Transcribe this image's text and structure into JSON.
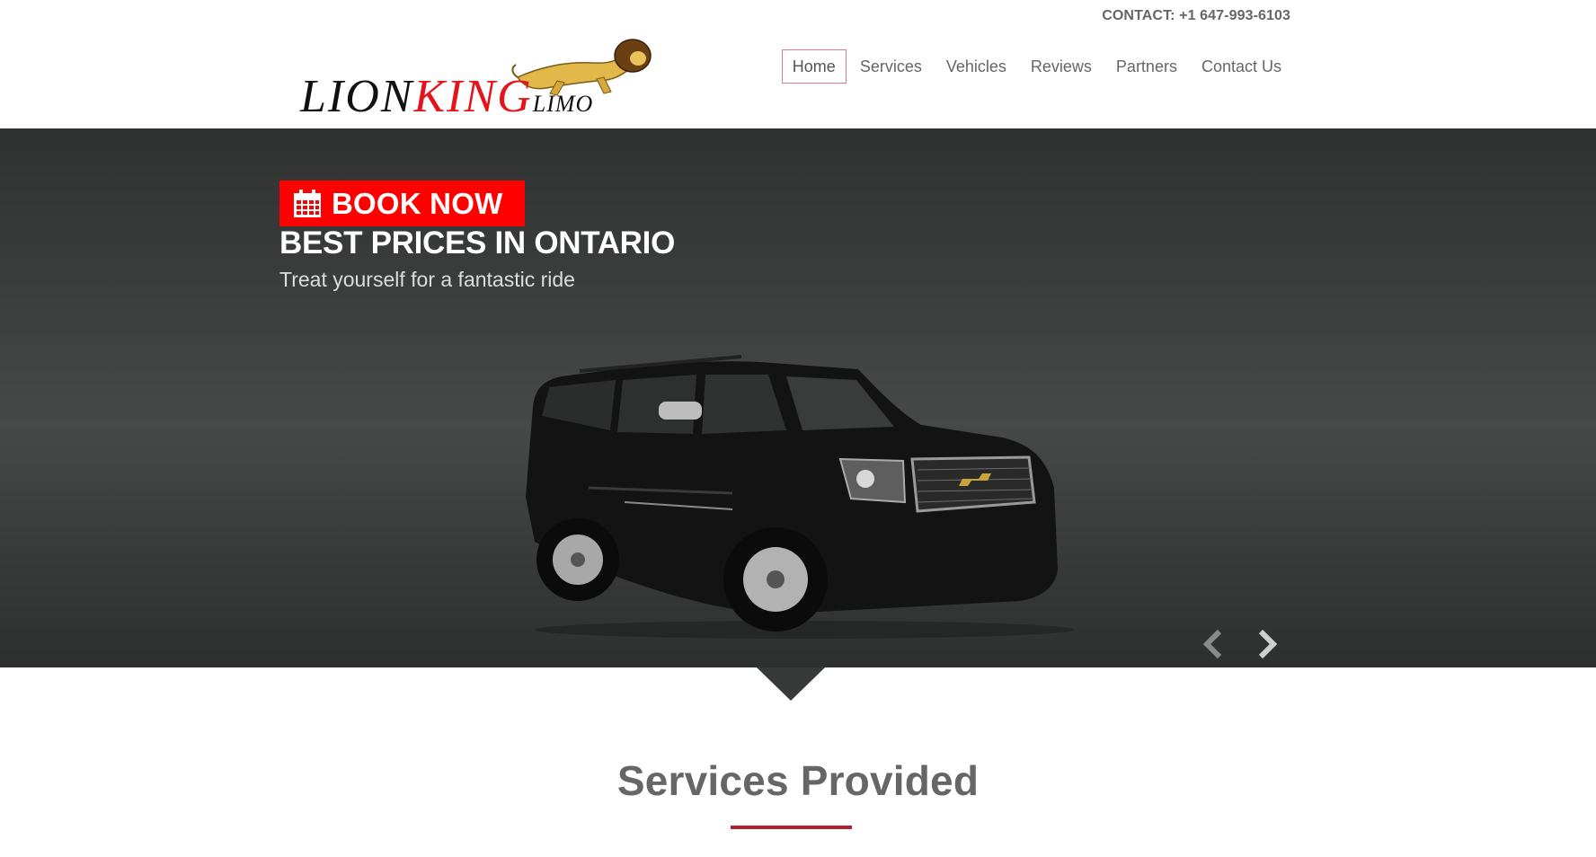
{
  "header": {
    "contact": "CONTACT: +1 647-993-6103",
    "logo": {
      "word1": "LION",
      "word2": "KING",
      "word3": "LIMO"
    },
    "nav": [
      {
        "label": "Home",
        "active": true
      },
      {
        "label": "Services",
        "active": false
      },
      {
        "label": "Vehicles",
        "active": false
      },
      {
        "label": "Reviews",
        "active": false
      },
      {
        "label": "Partners",
        "active": false
      },
      {
        "label": "Contact Us",
        "active": false
      }
    ]
  },
  "hero": {
    "book_now": "BOOK NOW",
    "title": "BEST PRICES IN ONTARIO",
    "subtitle": "Treat yourself for a fantastic ride",
    "prev_icon": "chevron-left-icon",
    "next_icon": "chevron-right-icon"
  },
  "services": {
    "title": "Services Provided"
  },
  "colors": {
    "accent_red": "#ff0000",
    "underline": "#b5202e",
    "nav_active_border": "#e07a8a",
    "hero_bg": "#3c3d3d",
    "text_gray": "#666666"
  }
}
